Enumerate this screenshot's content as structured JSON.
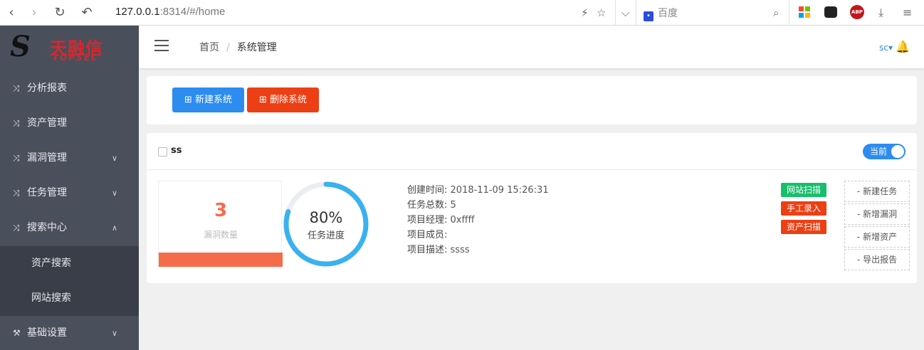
{
  "browser": {
    "url_host": "127.0.0.1",
    "url_rest": ":8314/#/home",
    "search_placeholder": "百度",
    "abp_label": "ABP"
  },
  "logo": {
    "cn": "天融信",
    "en": "TOPSEC"
  },
  "sidebar": {
    "items": [
      {
        "label": "分析报表"
      },
      {
        "label": "资产管理"
      },
      {
        "label": "漏洞管理"
      },
      {
        "label": "任务管理"
      },
      {
        "label": "搜索中心"
      },
      {
        "label": "基础设置"
      }
    ],
    "subitems": [
      {
        "label": "资产搜索"
      },
      {
        "label": "网站搜索"
      }
    ]
  },
  "header": {
    "breadcrumb_home": "首页",
    "breadcrumb_sep": "/",
    "breadcrumb_current": "系统管理",
    "user": "sc"
  },
  "toolbar": {
    "new_system": "新建系统",
    "delete_system": "删除系统"
  },
  "system": {
    "name": "ss",
    "toggle_label": "当前",
    "vuln_count": "3",
    "vuln_label": "漏洞数量",
    "progress": 0.8,
    "progress_text": "80%",
    "progress_label": "任务进度",
    "info": [
      {
        "key": "创建时间:",
        "value": "2018-11-09 15:26:31"
      },
      {
        "key": "任务总数:",
        "value": "5"
      },
      {
        "key": "项目经理:",
        "value": "0xffff"
      },
      {
        "key": "项目成员:",
        "value": ""
      },
      {
        "key": "项目描述:",
        "value": "ssss"
      }
    ],
    "tags": [
      "网站扫描",
      "手工录入",
      "资产扫描"
    ],
    "actions": [
      "新建任务",
      "新增漏洞",
      "新增资产",
      "导出报告"
    ]
  },
  "colors": {
    "primary": "#2d8cf0",
    "danger": "#ed3f14",
    "success": "#19be6b",
    "sidebar": "#4a4f5c",
    "ring": "#39b2ee",
    "vuln": "#f56c4b"
  }
}
